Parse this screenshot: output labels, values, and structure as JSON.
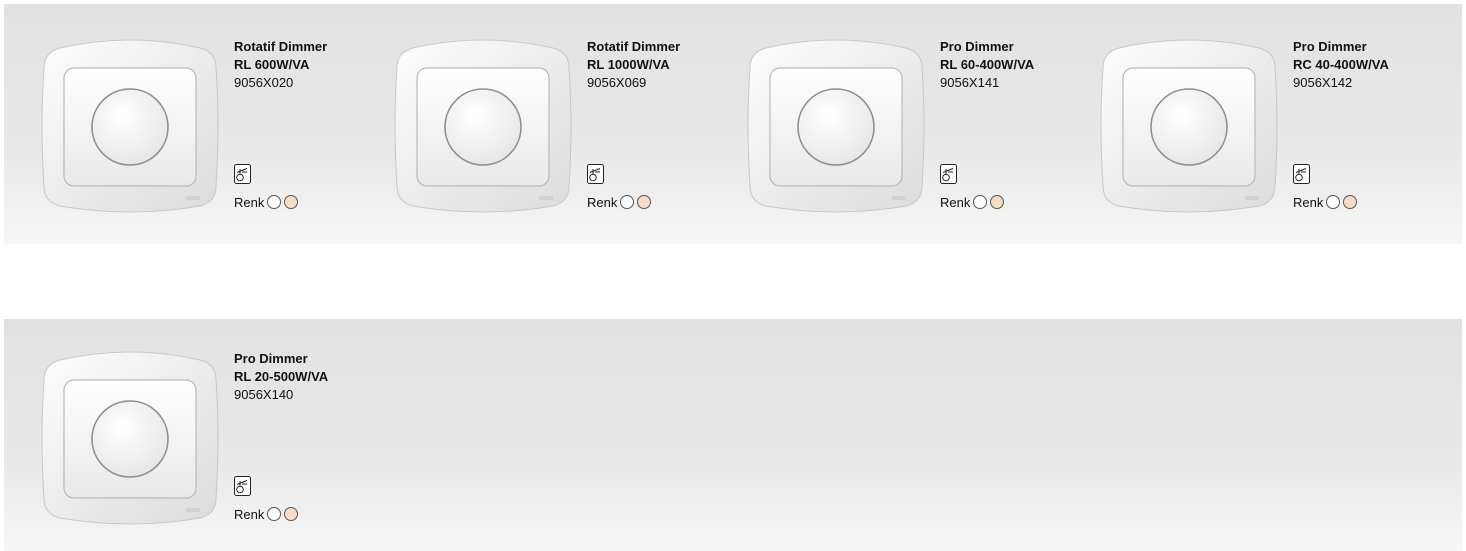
{
  "rows": [
    {
      "items": [
        {
          "name": "Rotatif Dimmer",
          "spec": "RL 600W/VA",
          "code": "9056X020",
          "color_label": "Renk",
          "colors": [
            "#ffffff",
            "#f7dcc5"
          ]
        },
        {
          "name": "Rotatif Dimmer",
          "spec": "RL 1000W/VA",
          "code": "9056X069",
          "color_label": "Renk",
          "colors": [
            "#ffffff",
            "#f7dcc5"
          ]
        },
        {
          "name": "Pro Dimmer",
          "spec": "RL 60-400W/VA",
          "code": "9056X141",
          "color_label": "Renk",
          "colors": [
            "#ffffff",
            "#f7dcc5"
          ]
        },
        {
          "name": "Pro Dimmer",
          "spec": "RC 40-400W/VA",
          "code": "9056X142",
          "color_label": "Renk",
          "colors": [
            "#ffffff",
            "#f7dcc5"
          ]
        }
      ]
    },
    {
      "items": [
        {
          "name": "Pro Dimmer",
          "spec": "RL 20-500W/VA",
          "code": "9056X140",
          "color_label": "Renk",
          "colors": [
            "#ffffff",
            "#f7dcc5"
          ]
        }
      ]
    }
  ],
  "icons": {
    "product_image": "rotary-dimmer-image",
    "symbol": "dimmer-symbol-icon"
  }
}
